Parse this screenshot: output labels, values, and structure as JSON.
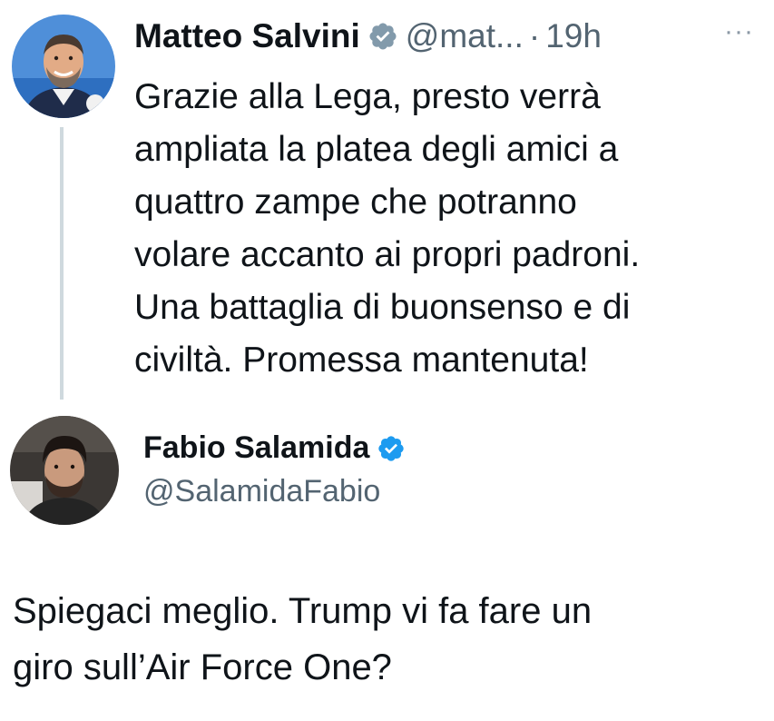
{
  "original_tweet": {
    "author_name": "Matteo Salvini",
    "handle": "@mat...",
    "separator": "·",
    "time": "19h",
    "more_label": "···",
    "lines": [
      "Grazie alla Lega, presto verrà",
      "ampliata la platea degli amici a",
      "quattro zampe che potranno",
      "volare accanto ai propri padroni.",
      "Una battaglia di buonsenso e di",
      "civiltà. Promessa mantenuta!"
    ],
    "badge_color": "#829aab"
  },
  "reply_tweet": {
    "author_name": "Fabio Salamida",
    "handle": "@SalamidaFabio",
    "lines": [
      "Spiegaci meglio. Trump vi fa fare un",
      "giro sull’Air Force One?"
    ],
    "badge_color": "#1d9bf0"
  },
  "icons": {
    "salvini_avatar": "avatar-photo-icon",
    "salamida_avatar": "avatar-photo-icon",
    "verified_badge": "verified-badge-icon",
    "more_options": "more-options-icon"
  }
}
